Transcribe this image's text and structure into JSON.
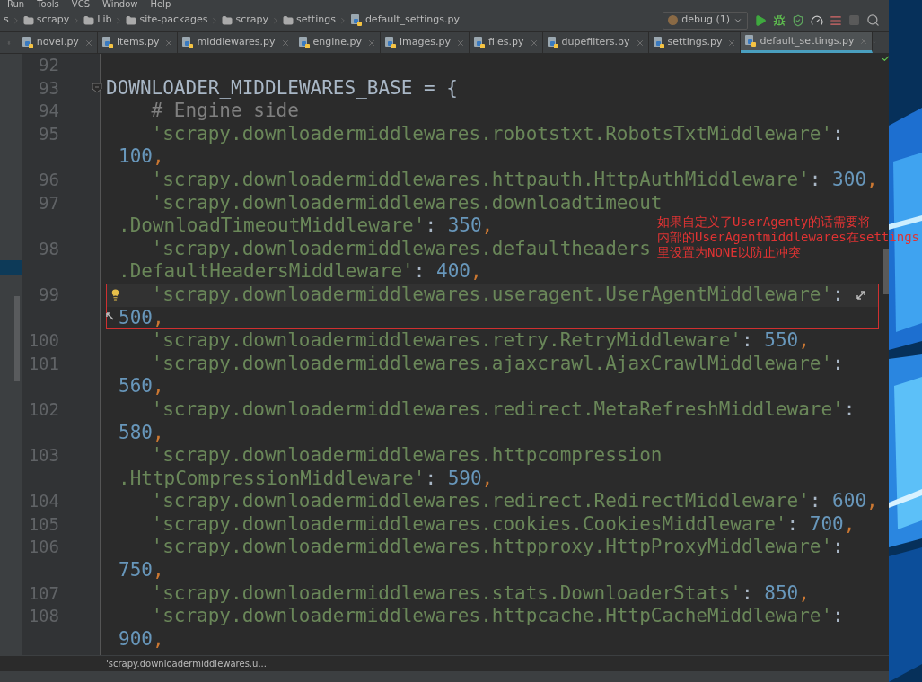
{
  "menu": [
    "Run",
    "Tools",
    "VCS",
    "Window",
    "Help"
  ],
  "breadcrumbs": [
    {
      "label": "s",
      "kind": "folder"
    },
    {
      "label": "scrapy",
      "kind": "folder"
    },
    {
      "label": "Lib",
      "kind": "folder"
    },
    {
      "label": "site-packages",
      "kind": "folder"
    },
    {
      "label": "scrapy",
      "kind": "folder"
    },
    {
      "label": "settings",
      "kind": "folder"
    },
    {
      "label": "default_settings.py",
      "kind": "file"
    }
  ],
  "run_config": {
    "label": "debug (1)"
  },
  "tabs": [
    {
      "label": "novel.py",
      "selected": false
    },
    {
      "label": "items.py",
      "selected": false
    },
    {
      "label": "middlewares.py",
      "selected": false
    },
    {
      "label": "engine.py",
      "selected": false
    },
    {
      "label": "images.py",
      "selected": false
    },
    {
      "label": "files.py",
      "selected": false
    },
    {
      "label": "dupefilters.py",
      "selected": false
    },
    {
      "label": "settings.py",
      "selected": false
    },
    {
      "label": "default_settings.py",
      "selected": true
    }
  ],
  "code": [
    {
      "number": "92",
      "boxed": false,
      "rows": [
        {
          "spans": []
        }
      ]
    },
    {
      "number": "93",
      "boxed": false,
      "rows": [
        {
          "spans": [
            {
              "kind": "plain",
              "text": "DOWNLOADER_MIDDLEWARES_BASE = {"
            }
          ]
        }
      ],
      "children": [
        {
          "number": "94",
          "boxed": false,
          "rows": [
            {
              "spans": [
                {
                  "kind": "comment",
                  "text": "# Engine side"
                }
              ]
            }
          ]
        },
        {
          "number": "95",
          "boxed": false,
          "rows": [
            {
              "spans": [
                {
                  "kind": "string",
                  "text": "'scrapy.downloadermiddlewares.robotstxt.RobotsTxtMiddleware'"
                },
                {
                  "kind": "plain",
                  "text": ":"
                }
              ]
            },
            {
              "spans": [
                {
                  "kind": "number",
                  "text": "100"
                },
                {
                  "kind": "punct",
                  "text": ","
                }
              ]
            }
          ]
        },
        {
          "number": "96",
          "boxed": false,
          "rows": [
            {
              "spans": [
                {
                  "kind": "string",
                  "text": "'scrapy.downloadermiddlewares.httpauth.HttpAuthMiddleware'"
                },
                {
                  "kind": "plain",
                  "text": ": "
                },
                {
                  "kind": "number",
                  "text": "300"
                },
                {
                  "kind": "punct",
                  "text": ","
                }
              ]
            }
          ]
        },
        {
          "number": "97",
          "boxed": false,
          "rows": [
            {
              "spans": [
                {
                  "kind": "string",
                  "text": "'scrapy.downloadermiddlewares.downloadtimeout"
                }
              ]
            },
            {
              "spans": [
                {
                  "kind": "string",
                  "text": ".DownloadTimeoutMiddleware'"
                },
                {
                  "kind": "plain",
                  "text": ": "
                },
                {
                  "kind": "number",
                  "text": "350"
                },
                {
                  "kind": "punct",
                  "text": ","
                }
              ]
            }
          ]
        },
        {
          "number": "98",
          "boxed": false,
          "rows": [
            {
              "spans": [
                {
                  "kind": "string",
                  "text": "'scrapy.downloadermiddlewares.defaultheaders"
                }
              ]
            },
            {
              "spans": [
                {
                  "kind": "string",
                  "text": ".DefaultHeadersMiddleware'"
                },
                {
                  "kind": "plain",
                  "text": ": "
                },
                {
                  "kind": "number",
                  "text": "400"
                },
                {
                  "kind": "punct",
                  "text": ","
                }
              ]
            }
          ]
        },
        {
          "number": "99",
          "boxed": true,
          "rows": [
            {
              "spans": [
                {
                  "kind": "string",
                  "text": "'scrapy.downloadermiddlewares.useragent.UserAgentMiddleware'"
                },
                {
                  "kind": "plain",
                  "text": ":"
                }
              ]
            },
            {
              "spans": [
                {
                  "kind": "number",
                  "text": "500"
                },
                {
                  "kind": "punct",
                  "text": ","
                }
              ]
            }
          ]
        },
        {
          "number": "100",
          "boxed": false,
          "rows": [
            {
              "spans": [
                {
                  "kind": "string",
                  "text": "'scrapy.downloadermiddlewares.retry.RetryMiddleware'"
                },
                {
                  "kind": "plain",
                  "text": ": "
                },
                {
                  "kind": "number",
                  "text": "550"
                },
                {
                  "kind": "punct",
                  "text": ","
                }
              ]
            }
          ]
        },
        {
          "number": "101",
          "boxed": false,
          "rows": [
            {
              "spans": [
                {
                  "kind": "string",
                  "text": "'scrapy.downloadermiddlewares.ajaxcrawl.AjaxCrawlMiddleware'"
                },
                {
                  "kind": "plain",
                  "text": ":"
                }
              ]
            },
            {
              "spans": [
                {
                  "kind": "number",
                  "text": "560"
                },
                {
                  "kind": "punct",
                  "text": ","
                }
              ]
            }
          ]
        },
        {
          "number": "102",
          "boxed": false,
          "rows": [
            {
              "spans": [
                {
                  "kind": "string",
                  "text": "'scrapy.downloadermiddlewares.redirect.MetaRefreshMiddleware'"
                },
                {
                  "kind": "plain",
                  "text": ":"
                }
              ]
            },
            {
              "spans": [
                {
                  "kind": "number",
                  "text": "580"
                },
                {
                  "kind": "punct",
                  "text": ","
                }
              ]
            }
          ]
        },
        {
          "number": "103",
          "boxed": false,
          "rows": [
            {
              "spans": [
                {
                  "kind": "string",
                  "text": "'scrapy.downloadermiddlewares.httpcompression"
                }
              ]
            },
            {
              "spans": [
                {
                  "kind": "string",
                  "text": ".HttpCompressionMiddleware'"
                },
                {
                  "kind": "plain",
                  "text": ": "
                },
                {
                  "kind": "number",
                  "text": "590"
                },
                {
                  "kind": "punct",
                  "text": ","
                }
              ]
            }
          ]
        },
        {
          "number": "104",
          "boxed": false,
          "rows": [
            {
              "spans": [
                {
                  "kind": "string",
                  "text": "'scrapy.downloadermiddlewares.redirect.RedirectMiddleware'"
                },
                {
                  "kind": "plain",
                  "text": ": "
                },
                {
                  "kind": "number",
                  "text": "600"
                },
                {
                  "kind": "punct",
                  "text": ","
                }
              ]
            }
          ]
        },
        {
          "number": "105",
          "boxed": false,
          "rows": [
            {
              "spans": [
                {
                  "kind": "string",
                  "text": "'scrapy.downloadermiddlewares.cookies.CookiesMiddleware'"
                },
                {
                  "kind": "plain",
                  "text": ": "
                },
                {
                  "kind": "number",
                  "text": "700"
                },
                {
                  "kind": "punct",
                  "text": ","
                }
              ]
            }
          ]
        },
        {
          "number": "106",
          "boxed": false,
          "rows": [
            {
              "spans": [
                {
                  "kind": "string",
                  "text": "'scrapy.downloadermiddlewares.httpproxy.HttpProxyMiddleware'"
                },
                {
                  "kind": "plain",
                  "text": ":"
                }
              ]
            },
            {
              "spans": [
                {
                  "kind": "number",
                  "text": "750"
                },
                {
                  "kind": "punct",
                  "text": ","
                }
              ]
            }
          ]
        },
        {
          "number": "107",
          "boxed": false,
          "rows": [
            {
              "spans": [
                {
                  "kind": "string",
                  "text": "'scrapy.downloadermiddlewares.stats.DownloaderStats'"
                },
                {
                  "kind": "plain",
                  "text": ": "
                },
                {
                  "kind": "number",
                  "text": "850"
                },
                {
                  "kind": "punct",
                  "text": ","
                }
              ]
            }
          ]
        },
        {
          "number": "108",
          "boxed": false,
          "rows": [
            {
              "spans": [
                {
                  "kind": "string",
                  "text": "'scrapy.downloadermiddlewares.httpcache.HttpCacheMiddleware'"
                },
                {
                  "kind": "plain",
                  "text": ":"
                }
              ]
            },
            {
              "spans": [
                {
                  "kind": "number",
                  "text": "900"
                },
                {
                  "kind": "punct",
                  "text": ","
                }
              ]
            }
          ]
        }
      ]
    }
  ],
  "annotation": {
    "lines": [
      "如果自定义了UserAgenty的话需要将",
      "内部的UserAgentmiddlewares在settings",
      "里设置为NONE以防止冲突"
    ]
  },
  "hint": "'scrapy.downloadermiddlewares.u..."
}
